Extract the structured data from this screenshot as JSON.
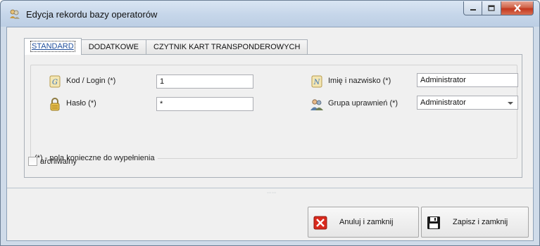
{
  "window": {
    "title": "Edycja rekordu bazy operatorów",
    "icon": "users-key-icon",
    "controls": {
      "minimize": "minimize-icon",
      "maximize": "maximize-icon",
      "close": "close-icon"
    }
  },
  "tabs": [
    {
      "label": "STANDARD",
      "active": true
    },
    {
      "label": "DODATKOWE",
      "active": false
    },
    {
      "label": "CZYTNIK KART TRANSPONDEROWYCH",
      "active": false
    }
  ],
  "form": {
    "login": {
      "label": "Kod / Login (*)",
      "value": "1",
      "icon": "login-card-icon"
    },
    "password": {
      "label": "Hasło (*)",
      "value": "*",
      "icon": "padlock-icon"
    },
    "name": {
      "label": "Imię i nazwisko (*)",
      "value": "Administrator",
      "icon": "name-card-icon"
    },
    "group": {
      "label": "Grupa uprawnień (*)",
      "value": "Administrator",
      "icon": "user-group-icon"
    },
    "required_note": "(*) - pola konieczne do wypełnienia",
    "archived": {
      "label": "archiwalny",
      "checked": false
    }
  },
  "buttons": {
    "cancel": {
      "label": "Anuluj i zamknij",
      "icon": "cancel-x-icon"
    },
    "save": {
      "label": "Zapisz i zamknij",
      "icon": "save-floppy-icon"
    }
  },
  "colors": {
    "window_frame": "#cfdbe9",
    "client_bg": "#f0f0f0",
    "close_button": "#c3381f",
    "cancel_red": "#d9291c"
  }
}
